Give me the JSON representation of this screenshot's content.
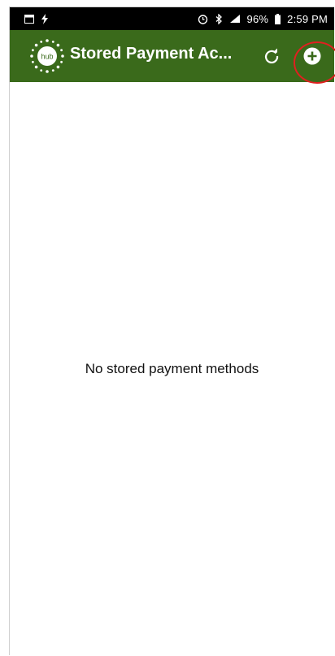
{
  "status_bar": {
    "battery": "96%",
    "time": "2:59 PM",
    "left_icons": [
      "notification-icon",
      "lightning-icon"
    ],
    "right_icons": [
      "alarm-icon",
      "bluetooth-icon",
      "signal-icon",
      "battery-icon"
    ]
  },
  "app_bar": {
    "logo_text": "hub",
    "title": "Stored Payment Ac...",
    "refresh_icon": "refresh-icon",
    "add_icon": "add-circle-icon",
    "color": "#3a6a1b"
  },
  "content": {
    "empty_message": "No stored payment methods"
  },
  "annotation": {
    "color": "#e02020"
  }
}
